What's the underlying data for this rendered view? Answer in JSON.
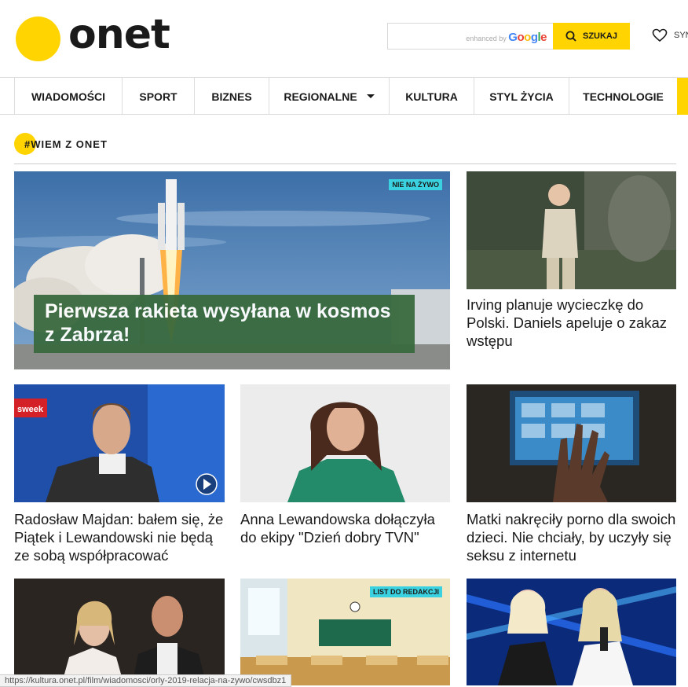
{
  "header": {
    "logo": "onet",
    "search": {
      "placeholder": "",
      "enhanced_by": "enhanced by",
      "google": "Google",
      "button": "SZUKAJ"
    },
    "favorites_label": "SYN"
  },
  "nav": {
    "items": [
      "WIADOMOŚCI",
      "SPORT",
      "BIZNES",
      "REGIONALNE",
      "KULTURA",
      "STYL ŻYCIA",
      "TECHNOLOGIE"
    ]
  },
  "section": {
    "title": "#WIEM Z ONET"
  },
  "articles": [
    {
      "title": "Pierwsza rakieta wysyłana w kosmos z Zabrza!",
      "badge": "NIE NA ŻYWO"
    },
    {
      "title": "Irving planuje wycieczkę do Polski. Daniels apeluje o zakaz wstępu"
    },
    {
      "title": "Radosław Majdan: bałem się, że Piątek i Lewandowski nie będą ze sobą współpracować"
    },
    {
      "title": "Anna Lewandowska dołączyła do ekipy \"Dzień dobry TVN\""
    },
    {
      "title": "Matki nakręciły porno dla swoich dzieci. Nie chciały, by uczyły się seksu z internetu"
    },
    {
      "title": ""
    },
    {
      "title": "",
      "badge": "LIST DO REDAKCJI"
    },
    {
      "title": ""
    }
  ],
  "status_bar": "https://kultura.onet.pl/film/wiadomosci/orly-2019-relacja-na-zywo/cwsdbz1",
  "colors": {
    "accent": "#ffd400",
    "badge": "#3ad2e0",
    "overlay": "#3a6a3e"
  }
}
